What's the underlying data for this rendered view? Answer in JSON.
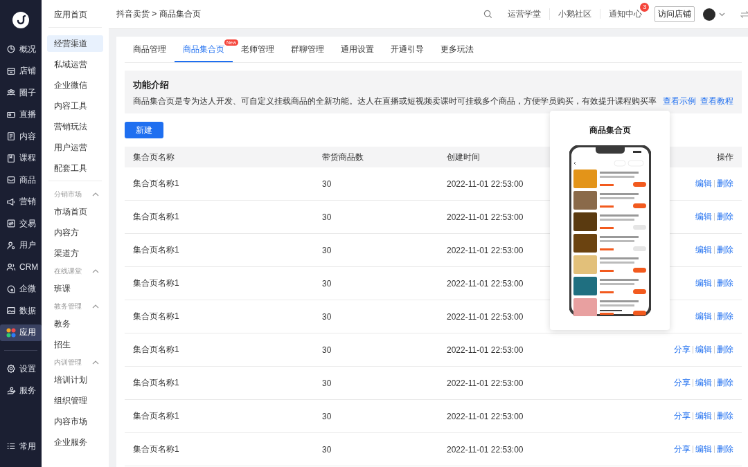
{
  "nav": {
    "items": [
      {
        "label": "概况",
        "selected": false
      },
      {
        "label": "店铺",
        "selected": false
      },
      {
        "label": "圈子",
        "selected": false
      },
      {
        "label": "直播",
        "selected": false
      },
      {
        "label": "内容",
        "selected": false
      },
      {
        "label": "课程",
        "selected": false
      },
      {
        "label": "商品",
        "selected": false
      },
      {
        "label": "营销",
        "selected": false
      },
      {
        "label": "交易",
        "selected": false
      },
      {
        "label": "用户",
        "selected": false
      },
      {
        "label": "CRM",
        "selected": false
      },
      {
        "label": "企微",
        "selected": false
      },
      {
        "label": "数据",
        "selected": false
      },
      {
        "label": "应用",
        "selected": true
      }
    ],
    "bottom_items": [
      {
        "label": "设置",
        "selected": false
      },
      {
        "label": "服务",
        "selected": false
      }
    ],
    "footer": {
      "label": "常用"
    }
  },
  "subnav": [
    {
      "kind": "link",
      "label": "应用首页",
      "selected": false
    },
    {
      "kind": "divider"
    },
    {
      "kind": "link",
      "label": "经营渠道",
      "selected": true
    },
    {
      "kind": "link",
      "label": "私域运营",
      "selected": false
    },
    {
      "kind": "link",
      "label": "企业微信",
      "selected": false
    },
    {
      "kind": "link",
      "label": "内容工具",
      "selected": false
    },
    {
      "kind": "link",
      "label": "营销玩法",
      "selected": false
    },
    {
      "kind": "link",
      "label": "用户运营",
      "selected": false
    },
    {
      "kind": "link",
      "label": "配套工具",
      "selected": false
    },
    {
      "kind": "divider"
    },
    {
      "kind": "group",
      "label": "分销市场",
      "expanded": true
    },
    {
      "kind": "link",
      "label": "市场首页",
      "selected": false
    },
    {
      "kind": "link",
      "label": "内容方",
      "selected": false
    },
    {
      "kind": "link",
      "label": "渠道方",
      "selected": false
    },
    {
      "kind": "group",
      "label": "在线课堂",
      "expanded": true
    },
    {
      "kind": "link",
      "label": "班课",
      "selected": false
    },
    {
      "kind": "group",
      "label": "教务管理",
      "expanded": true
    },
    {
      "kind": "link",
      "label": "教务",
      "selected": false
    },
    {
      "kind": "link",
      "label": "招生",
      "selected": false
    },
    {
      "kind": "group",
      "label": "内训管理",
      "expanded": true
    },
    {
      "kind": "link",
      "label": "培训计划",
      "selected": false
    },
    {
      "kind": "link",
      "label": "组织管理",
      "selected": false
    },
    {
      "kind": "link",
      "label": "内容市场",
      "selected": false
    },
    {
      "kind": "link",
      "label": "企业服务",
      "selected": false
    }
  ],
  "topbar": {
    "breadcrumb": "抖音卖货 > 商品集合页",
    "links": [
      "运营学堂",
      "小鹅社区"
    ],
    "notifications": {
      "label": "通知中心",
      "count": "3"
    },
    "visit_button": "访问店铺"
  },
  "tabs": [
    {
      "label": "商品管理",
      "selected": false
    },
    {
      "label": "商品集合页",
      "selected": true,
      "badge": "New"
    },
    {
      "label": "老师管理",
      "selected": false
    },
    {
      "label": "群聊管理",
      "selected": false
    },
    {
      "label": "通用设置",
      "selected": false
    },
    {
      "label": "开通引导",
      "selected": false
    },
    {
      "label": "更多玩法",
      "selected": false
    }
  ],
  "intro": {
    "title": "功能介绍",
    "text": "商品集合页是专为达人开发、可自定义挂载商品的全新功能。达人在直播或短视频卖课时可挂载多个商品，方便学员购买，有效提升课程购买率",
    "links": [
      "查看示例",
      "查看教程"
    ]
  },
  "new_button": "新建",
  "table": {
    "columns": [
      "集合页名称",
      "带货商品数",
      "创建时间",
      "操作"
    ],
    "rows": [
      {
        "name": "集合页名称1",
        "count": "30",
        "created": "2022-11-01 22:53:00",
        "actions": [
          "编辑",
          "删除"
        ]
      },
      {
        "name": "集合页名称1",
        "count": "30",
        "created": "2022-11-01 22:53:00",
        "actions": [
          "编辑",
          "删除"
        ]
      },
      {
        "name": "集合页名称1",
        "count": "30",
        "created": "2022-11-01 22:53:00",
        "actions": [
          "编辑",
          "删除"
        ]
      },
      {
        "name": "集合页名称1",
        "count": "30",
        "created": "2022-11-01 22:53:00",
        "actions": [
          "编辑",
          "删除"
        ]
      },
      {
        "name": "集合页名称1",
        "count": "30",
        "created": "2022-11-01 22:53:00",
        "actions": [
          "编辑",
          "删除"
        ]
      },
      {
        "name": "集合页名称1",
        "count": "30",
        "created": "2022-11-01 22:53:00",
        "actions": [
          "分享",
          "编辑",
          "删除"
        ]
      },
      {
        "name": "集合页名称1",
        "count": "30",
        "created": "2022-11-01 22:53:00",
        "actions": [
          "分享",
          "编辑",
          "删除"
        ]
      },
      {
        "name": "集合页名称1",
        "count": "30",
        "created": "2022-11-01 22:53:00",
        "actions": [
          "分享",
          "编辑",
          "删除"
        ]
      },
      {
        "name": "集合页名称1",
        "count": "30",
        "created": "2022-11-01 22:53:00",
        "actions": [
          "分享",
          "编辑",
          "删除"
        ]
      }
    ]
  },
  "popup": {
    "title": "商品集合页"
  }
}
